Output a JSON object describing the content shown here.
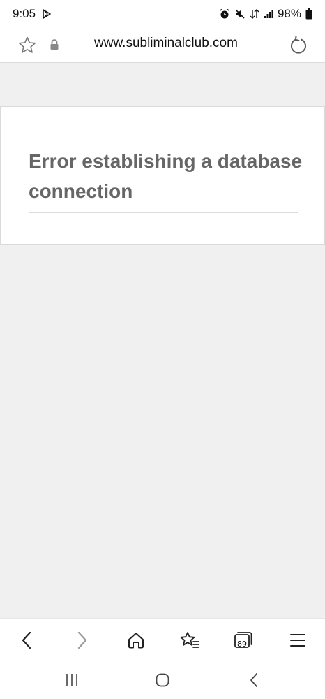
{
  "status_bar": {
    "time": "9:05",
    "battery_percent": "98%",
    "icons": [
      "play-store-icon",
      "alarm-icon",
      "mute-icon",
      "data-transfer-icon",
      "signal-icon",
      "battery-icon"
    ]
  },
  "address_bar": {
    "url": "www.subliminalclub.com",
    "icons": [
      "star-icon",
      "lock-icon",
      "reload-icon"
    ]
  },
  "page": {
    "error_title": "Error establishing a database connection"
  },
  "toolbar": {
    "tab_count": "89",
    "icons": [
      "back-arrow-icon",
      "forward-arrow-icon",
      "home-icon",
      "bookmarks-icon",
      "tabs-icon",
      "menu-icon"
    ]
  },
  "system_nav": {
    "icons": [
      "recents-icon",
      "home-circle-icon",
      "back-chevron-icon"
    ]
  },
  "colors": {
    "page_background": "#f0f0f0",
    "card_background": "#ffffff",
    "error_text": "#666666"
  }
}
